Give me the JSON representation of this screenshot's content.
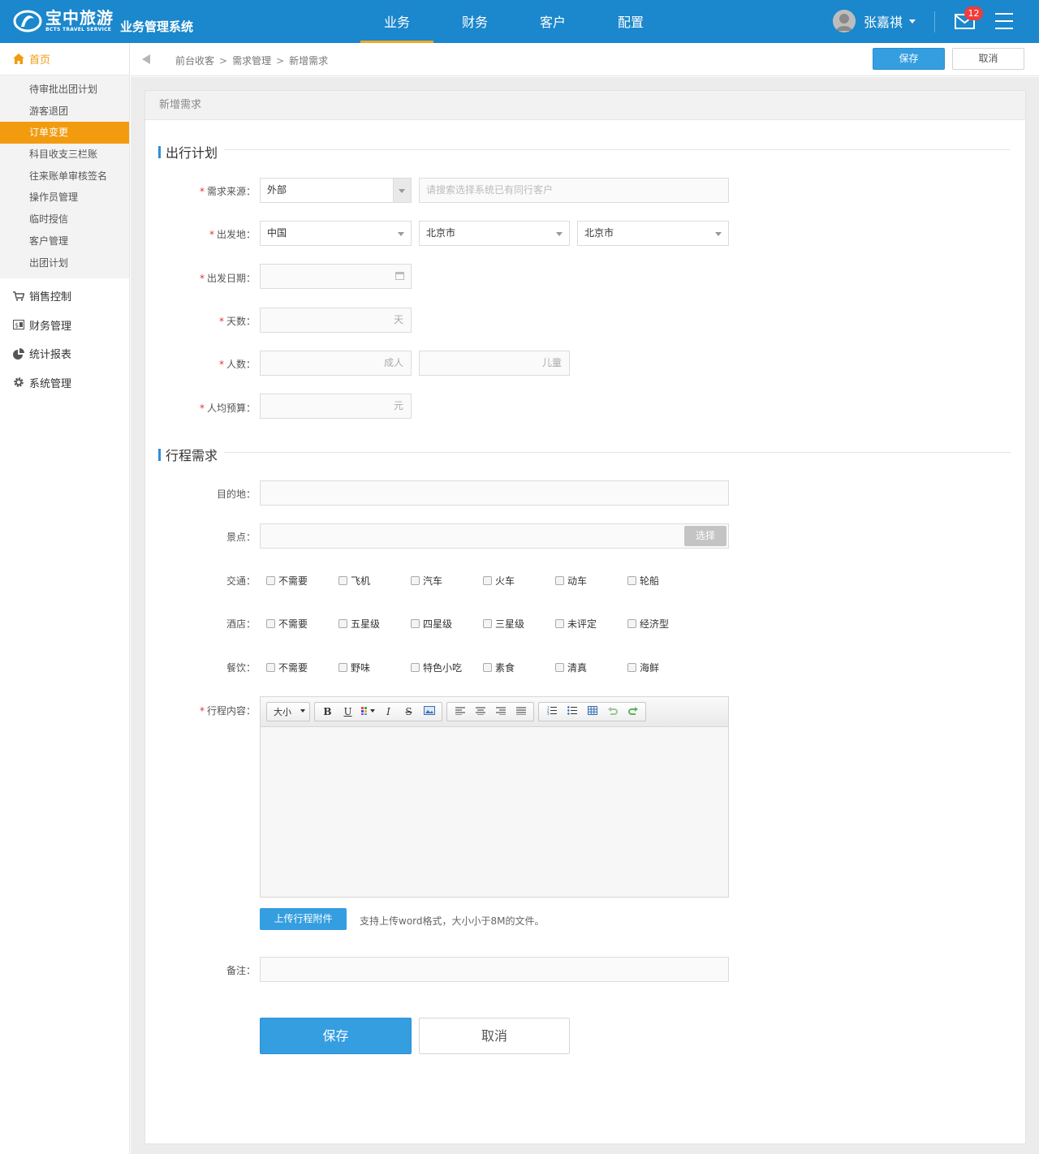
{
  "header": {
    "brand_cn": "宝中旅游",
    "brand_en": "BCTS TRAVEL SERVICE",
    "system_name": "业务管理系统",
    "nav": [
      "业务",
      "财务",
      "客户",
      "配置"
    ],
    "active_nav": "业务",
    "user_name": "张嘉祺",
    "mail_count": "12",
    "accent_color": "#1b87cc"
  },
  "sidebar": {
    "home": "首页",
    "sub_items": [
      "待审批出团计划",
      "游客退团",
      "订单变更",
      "科目收支三栏账",
      "往来账单审核签名",
      "操作员管理",
      "临时授信",
      "客户管理",
      "出团计划"
    ],
    "active_sub": "订单变更",
    "groups": [
      "销售控制",
      "财务管理",
      "统计报表",
      "系统管理"
    ],
    "highlight_color": "#f29b0f"
  },
  "breadcrumb": {
    "items": [
      "前台收客",
      "需求管理",
      "新增需求"
    ],
    "separator": ">",
    "save": "保存",
    "cancel": "取消"
  },
  "panel": {
    "title": "新增需求"
  },
  "plan": {
    "section": "出行计划",
    "source_label": "需求来源：",
    "source_value": "外部",
    "customer_placeholder": "请搜索选择系统已有同行客户",
    "origin_label": "出发地：",
    "origin_country": "中国",
    "origin_province": "北京市",
    "origin_city": "北京市",
    "date_label": "出发日期：",
    "days_label": "天数：",
    "days_unit": "天",
    "people_label": "人数：",
    "adult_unit": "成人",
    "child_unit": "儿童",
    "budget_label": "人均预算：",
    "budget_unit": "元"
  },
  "itinerary": {
    "section": "行程需求",
    "destination_label": "目的地：",
    "spots_label": "景点：",
    "spots_button": "选择",
    "transport_label": "交通：",
    "transport_options": [
      "不需要",
      "飞机",
      "汽车",
      "火车",
      "动车",
      "轮船"
    ],
    "hotel_label": "酒店：",
    "hotel_options": [
      "不需要",
      "五星级",
      "四星级",
      "三星级",
      "未评定",
      "经济型"
    ],
    "food_label": "餐饮：",
    "food_options": [
      "不需要",
      "野味",
      "特色小吃",
      "素食",
      "清真",
      "海鲜"
    ],
    "content_label": "行程内容：",
    "editor_size": "大小",
    "upload_button": "上传行程附件",
    "upload_tip": "支持上传word格式，大小小于8M的文件。",
    "remark_label": "备注："
  },
  "actions": {
    "save": "保存",
    "cancel": "取消"
  }
}
